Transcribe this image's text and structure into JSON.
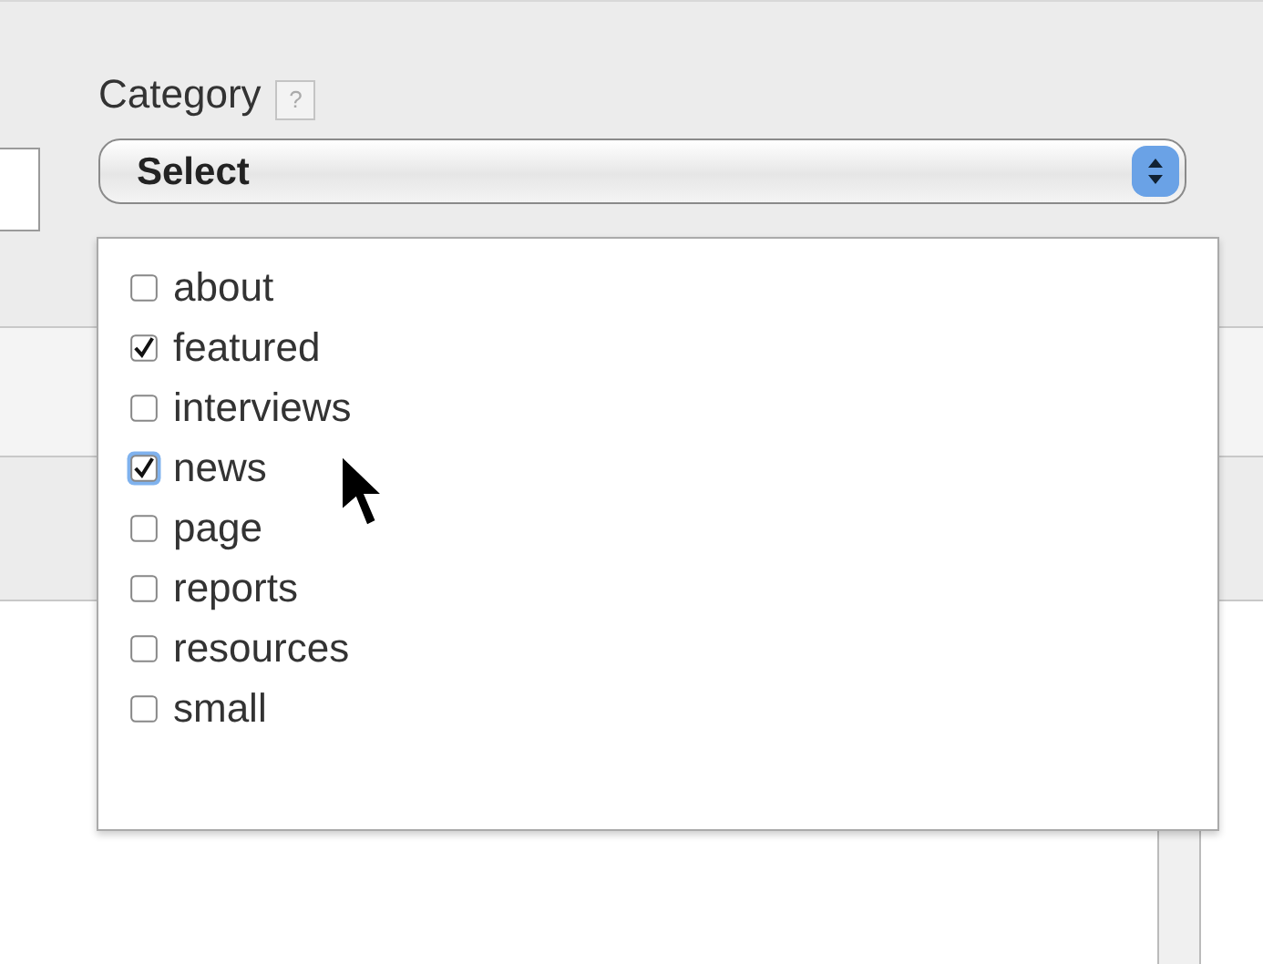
{
  "field": {
    "label": "Category",
    "help": "?",
    "select": "Select"
  },
  "options": [
    {
      "label": "about",
      "checked": false,
      "focused": false
    },
    {
      "label": "featured",
      "checked": true,
      "focused": false
    },
    {
      "label": "interviews",
      "checked": false,
      "focused": false
    },
    {
      "label": "news",
      "checked": true,
      "focused": true
    },
    {
      "label": "page",
      "checked": false,
      "focused": false
    },
    {
      "label": "reports",
      "checked": false,
      "focused": false
    },
    {
      "label": "resources",
      "checked": false,
      "focused": false
    },
    {
      "label": "small",
      "checked": false,
      "focused": false
    }
  ]
}
